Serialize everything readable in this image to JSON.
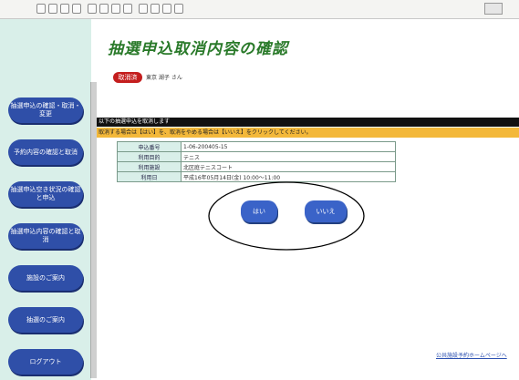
{
  "page": {
    "title": "抽選申込取消内容の確認",
    "status_badge": "取消済",
    "user_name": "東京 湖子 さん",
    "message_line": "以下の抽選申込を取消します",
    "instruction_line": "取消する場合は【はい】を、取消をやめる場合は【いいえ】をクリックしてください。"
  },
  "details": [
    {
      "label": "申込番号",
      "value": "1-06-200405-15"
    },
    {
      "label": "利用目的",
      "value": "テニス"
    },
    {
      "label": "利用施設",
      "value": "北区庭テニスコート"
    },
    {
      "label": "利用日",
      "value": "平成16年05月14日(金) 10:00～11:00"
    }
  ],
  "buttons": {
    "yes": "はい",
    "no": "いいえ"
  },
  "sidebar": {
    "items": [
      {
        "label": "抽選申込の確認・取消・変更"
      },
      {
        "label": "予約内容の確認と取消"
      },
      {
        "label": "抽選申込空き状況の確認と申込"
      },
      {
        "label": "抽選申込内容の確認と取消"
      },
      {
        "label": "施設のご案内"
      },
      {
        "label": "抽選のご案内"
      },
      {
        "label": "ログアウト"
      }
    ]
  },
  "footer_link": "公共施設予約ホームページへ"
}
